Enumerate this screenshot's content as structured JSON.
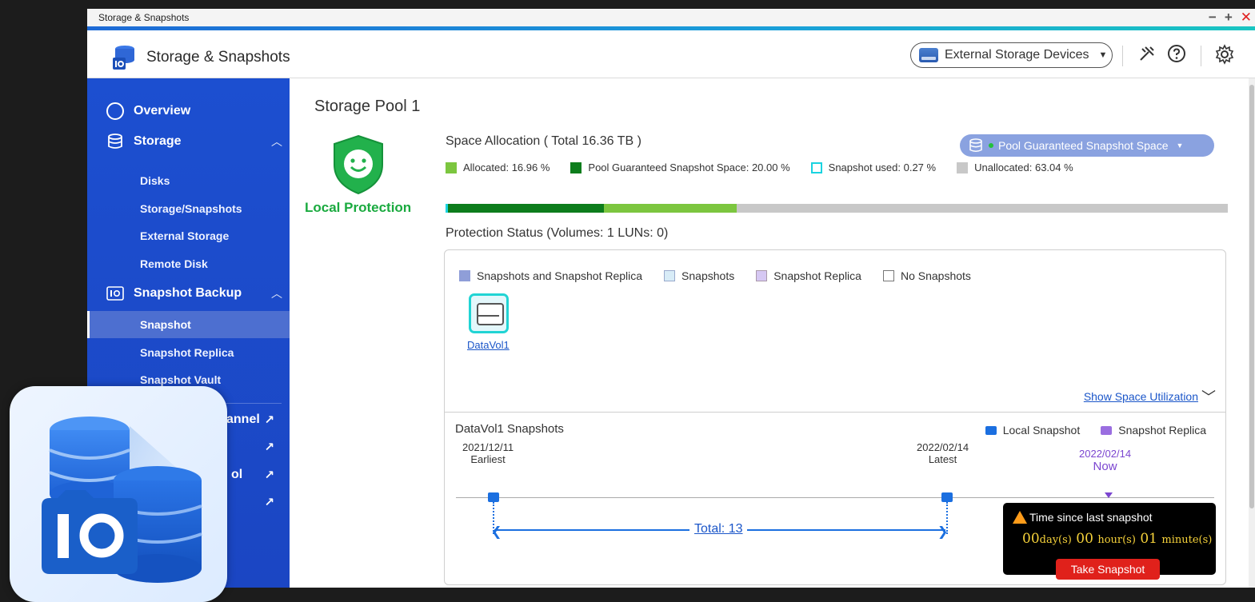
{
  "window": {
    "title": "Storage & Snapshots",
    "controls": [
      "−",
      "+",
      "✕"
    ]
  },
  "app": {
    "title": "Storage & Snapshots",
    "device_select": "External Storage Devices"
  },
  "sidebar": {
    "overview": "Overview",
    "storage": "Storage",
    "storage_items": [
      "Disks",
      "Storage/Snapshots",
      "External Storage",
      "Remote Disk"
    ],
    "snapshot_backup": "Snapshot Backup",
    "snapshot_items": [
      "Snapshot",
      "Snapshot Replica",
      "Snapshot Vault"
    ],
    "partial_items": [
      "annel",
      "",
      "ol",
      ""
    ]
  },
  "main": {
    "pool_title": "Storage Pool 1",
    "local_protection": "Local Protection",
    "space_title": "Space Allocation ( Total 16.36 TB )",
    "pool_button": "Pool Guaranteed Snapshot Space",
    "legend": [
      {
        "label": "Allocated: 16.96 %",
        "color": "#7cc63f"
      },
      {
        "label": "Pool Guaranteed Snapshot Space: 20.00 %",
        "color": "#0d7d1c"
      },
      {
        "label": "Snapshot used: 0.27 %",
        "color": "#1ad3e0"
      },
      {
        "label": "Unallocated: 63.04 %",
        "color": "#c8c8c8"
      }
    ],
    "allocation": {
      "snapshot_used": 0.27,
      "guaranteed": 20.0,
      "allocated": 16.96,
      "unallocated": 63.04
    },
    "protection_title": "Protection Status (Volumes: 1 LUNs: 0)",
    "protection_legend": [
      {
        "label": "Snapshots and Snapshot Replica",
        "color": "#8f9ed8"
      },
      {
        "label": "Snapshots",
        "color": "#d8ecf7"
      },
      {
        "label": "Snapshot Replica",
        "color": "#d6c8f3"
      },
      {
        "label": "No Snapshots",
        "color": "#ffffff"
      }
    ],
    "volume_name": "DataVol1",
    "show_space": "Show Space Utilization"
  },
  "snapshots": {
    "title": "DataVol1 Snapshots",
    "legend_local": "Local Snapshot",
    "legend_replica": "Snapshot Replica",
    "earliest_date": "2021/12/11",
    "earliest_label": "Earliest",
    "latest_date": "2022/02/14",
    "latest_label": "Latest",
    "now_date": "2022/02/14",
    "now_label": "Now",
    "total": "Total: 13",
    "tooltip_title": "Time since last snapshot",
    "tooltip_days": "00",
    "tooltip_days_unit": "day(s)",
    "tooltip_hours": "00",
    "tooltip_hours_unit": "hour(s)",
    "tooltip_minutes": "01",
    "tooltip_minutes_unit": "minute(s)",
    "tooltip_button": "Take Snapshot"
  }
}
